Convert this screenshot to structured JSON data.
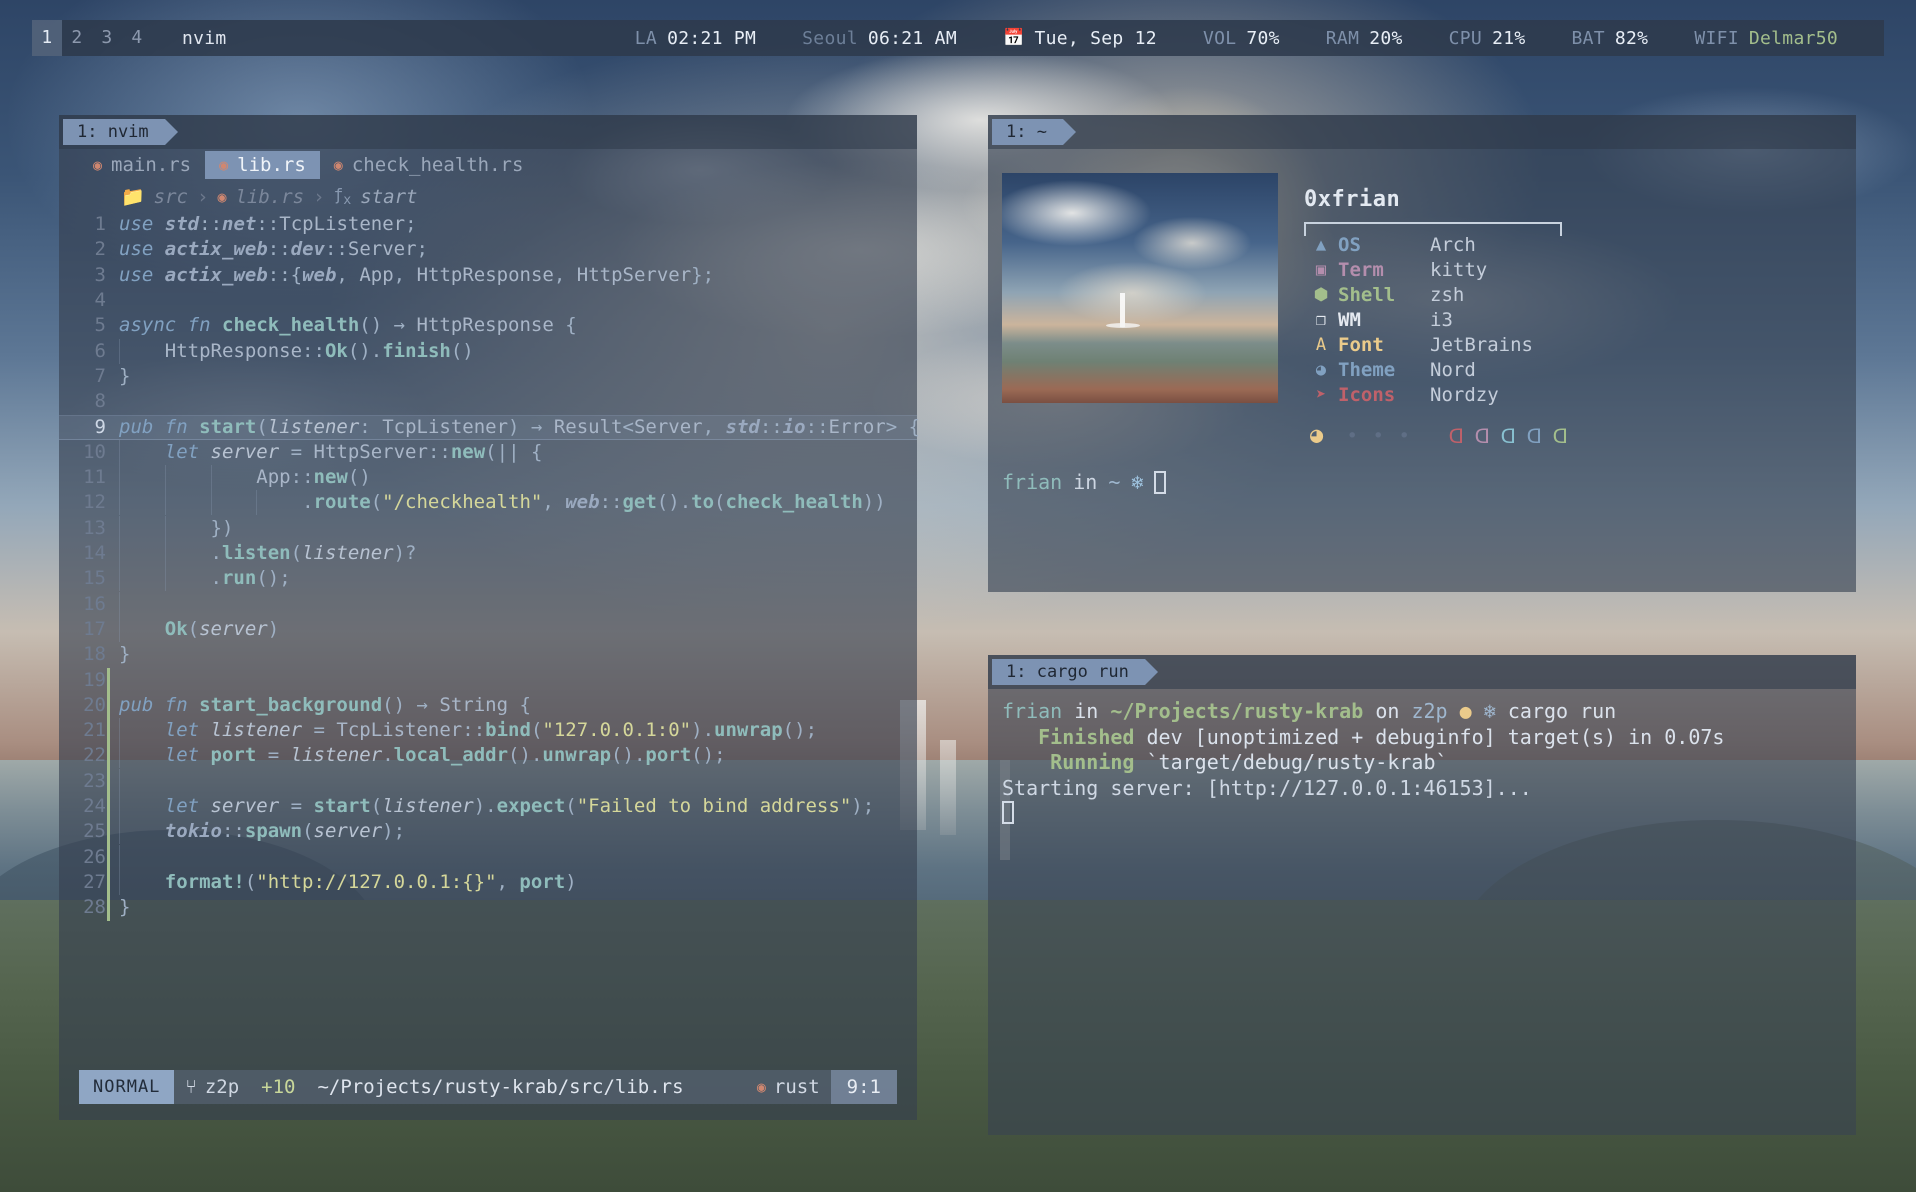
{
  "topbar": {
    "workspaces": [
      "1",
      "2",
      "3",
      "4"
    ],
    "active_workspace": "1",
    "window_title": "nvim",
    "clock_la_label": "LA",
    "clock_la_time": "02:21 PM",
    "clock_seoul_label": "Seoul",
    "clock_seoul_time": "06:21 AM",
    "calendar_icon": "calendar-icon",
    "date": "Tue, Sep 12",
    "vol_label": "VOL",
    "vol_value": "70%",
    "ram_label": "RAM",
    "ram_value": "20%",
    "cpu_label": "CPU",
    "cpu_value": "21%",
    "bat_label": "BAT",
    "bat_value": "82%",
    "wifi_label": "WIFI",
    "wifi_value": "Delmar50"
  },
  "nvim": {
    "tag": "1: nvim",
    "buffers": [
      {
        "label": "main.rs",
        "active": false
      },
      {
        "label": "lib.rs",
        "active": true
      },
      {
        "label": "check_health.rs",
        "active": false
      }
    ],
    "breadcrumb": {
      "folder": "src",
      "file": "lib.rs",
      "symbol": "start",
      "sep": "›"
    },
    "statusline": {
      "mode": "NORMAL",
      "branch": "z2p",
      "added": "+10",
      "path": "~/Projects/rusty-krab/src/lib.rs",
      "filetype": "rust",
      "position": "9:1"
    },
    "cursor_line": 9,
    "lines": [
      {
        "n": 1,
        "text": "use std::net::TcpListener;"
      },
      {
        "n": 2,
        "text": "use actix_web::dev::Server;"
      },
      {
        "n": 3,
        "text": "use actix_web::{web, App, HttpResponse, HttpServer};"
      },
      {
        "n": 4,
        "text": ""
      },
      {
        "n": 5,
        "text": "async fn check_health() → HttpResponse {"
      },
      {
        "n": 6,
        "text": "    HttpResponse::Ok().finish()"
      },
      {
        "n": 7,
        "text": "}"
      },
      {
        "n": 8,
        "text": ""
      },
      {
        "n": 9,
        "text": "pub fn start(listener: TcpListener) → Result<Server, std::io::Error> {"
      },
      {
        "n": 10,
        "text": "    let server = HttpServer::new(|| {"
      },
      {
        "n": 11,
        "text": "            App::new()"
      },
      {
        "n": 12,
        "text": "                .route(\"/checkhealth\", web::get().to(check_health))"
      },
      {
        "n": 13,
        "text": "        })"
      },
      {
        "n": 14,
        "text": "        .listen(listener)?"
      },
      {
        "n": 15,
        "text": "        .run();"
      },
      {
        "n": 16,
        "text": ""
      },
      {
        "n": 17,
        "text": "    Ok(server)"
      },
      {
        "n": 18,
        "text": "}"
      },
      {
        "n": 19,
        "text": ""
      },
      {
        "n": 20,
        "text": "pub fn start_background() → String {"
      },
      {
        "n": 21,
        "text": "    let listener = TcpListener::bind(\"127.0.0.1:0\").unwrap();"
      },
      {
        "n": 22,
        "text": "    let port = listener.local_addr().unwrap().port();"
      },
      {
        "n": 23,
        "text": ""
      },
      {
        "n": 24,
        "text": "    let server = start(listener).expect(\"Failed to bind address\");"
      },
      {
        "n": 25,
        "text": "    tokio::spawn(server);"
      },
      {
        "n": 26,
        "text": ""
      },
      {
        "n": 27,
        "text": "    format!(\"http://127.0.0.1:{}\", port)"
      },
      {
        "n": 28,
        "text": "}"
      }
    ]
  },
  "term_fetch": {
    "tag": "1: ~",
    "username": "0xfrian",
    "rows": [
      {
        "icon": "arch-icon",
        "glyph": "▲",
        "key": "OS",
        "value": "Arch",
        "color": "#81a1c1"
      },
      {
        "icon": "terminal-icon",
        "glyph": "▣",
        "key": "Term",
        "value": "kitty",
        "color": "#b48ead"
      },
      {
        "icon": "shell-icon",
        "glyph": "⬢",
        "key": "Shell",
        "value": "zsh",
        "color": "#a3be8c"
      },
      {
        "icon": "window-icon",
        "glyph": "❐",
        "key": "WM",
        "value": "i3",
        "color": "#e5e9f0"
      },
      {
        "icon": "font-icon",
        "glyph": "A",
        "key": "Font",
        "value": "JetBrains",
        "color": "#ebcb8b"
      },
      {
        "icon": "palette-icon",
        "glyph": "◕",
        "key": "Theme",
        "value": "Nord",
        "color": "#81a1c1"
      },
      {
        "icon": "cursor-icon",
        "glyph": "➤",
        "key": "Icons",
        "value": "Nordzy",
        "color": "#bf616a"
      }
    ],
    "palette": {
      "pacman": "◕",
      "pacman_color": "#ebcb8b",
      "dots": 3,
      "dot_color": "#5f6e85",
      "ghost_colors": [
        "#bf616a",
        "#b48ead",
        "#88c0d0",
        "#81a1c1",
        "#a3be8c"
      ]
    },
    "prompt": {
      "user": "frian",
      "in": "in",
      "dir": "~",
      "flake": "❄",
      "cursor": "block-cursor"
    }
  },
  "term_cargo": {
    "tag": "1: cargo run",
    "prompt": {
      "user": "frian",
      "in": "in",
      "dir": "~/Projects/rusty-krab",
      "on": "on",
      "branch": "z2p",
      "dirty_dot": "●",
      "flake": "❄",
      "command": "cargo run"
    },
    "lines": [
      {
        "label": "Finished",
        "rest": " dev [unoptimized + debuginfo] target(s) in 0.07s"
      },
      {
        "label": "Running",
        "rest": " `target/debug/rusty-krab`"
      }
    ],
    "output": "Starting server: [http://127.0.0.1:46153]...",
    "cursor": "block-cursor"
  }
}
